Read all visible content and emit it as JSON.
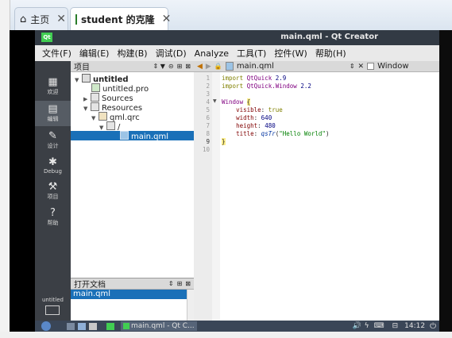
{
  "browser_tabs": [
    {
      "label": "主页",
      "icon": "home-icon"
    },
    {
      "label": "student 的克隆",
      "icon": "vm-icon"
    }
  ],
  "window": {
    "title": "main.qml - Qt Creator"
  },
  "menu": [
    "文件(F)",
    "编辑(E)",
    "构建(B)",
    "调试(D)",
    "Analyze",
    "工具(T)",
    "控件(W)",
    "帮助(H)"
  ],
  "modes": [
    {
      "label": "欢迎",
      "icon": "grid-icon"
    },
    {
      "label": "编辑",
      "icon": "edit-icon"
    },
    {
      "label": "设计",
      "icon": "pen-icon"
    },
    {
      "label": "Debug",
      "icon": "bug-icon"
    },
    {
      "label": "项目",
      "icon": "wrench-icon"
    },
    {
      "label": "帮助",
      "icon": "help-icon"
    }
  ],
  "project_pane": {
    "title": "项目",
    "tree": [
      {
        "label": "untitled",
        "level": 0,
        "expanded": true,
        "bold": true,
        "icon": "project-icon"
      },
      {
        "label": "untitled.pro",
        "level": 1,
        "icon": "pro-file-icon"
      },
      {
        "label": "Sources",
        "level": 1,
        "collapsed": true,
        "icon": "folder-icon"
      },
      {
        "label": "Resources",
        "level": 1,
        "expanded": true,
        "icon": "folder-icon"
      },
      {
        "label": "qml.qrc",
        "level": 2,
        "expanded": true,
        "icon": "qrc-file-icon"
      },
      {
        "label": "/",
        "level": 3,
        "expanded": true,
        "icon": "folder-icon"
      },
      {
        "label": "main.qml",
        "level": 4,
        "selected": true,
        "icon": "qml-file-icon"
      }
    ]
  },
  "open_docs": {
    "title": "打开文档",
    "items": [
      "main.qml"
    ]
  },
  "editor": {
    "file": "main.qml",
    "symbol": "Window",
    "line_numbers": [
      "1",
      "2",
      "3",
      "4",
      "5",
      "6",
      "7",
      "8",
      "9",
      "10"
    ],
    "current_line": 9
  },
  "kit": {
    "name": "untitled"
  },
  "taskbar": {
    "app_label": "main.qml - Qt C...",
    "time": "14:12"
  },
  "colors": {
    "accent": "#1a70b8",
    "sidebar": "#3b3f45",
    "titlebar": "#323a44"
  }
}
